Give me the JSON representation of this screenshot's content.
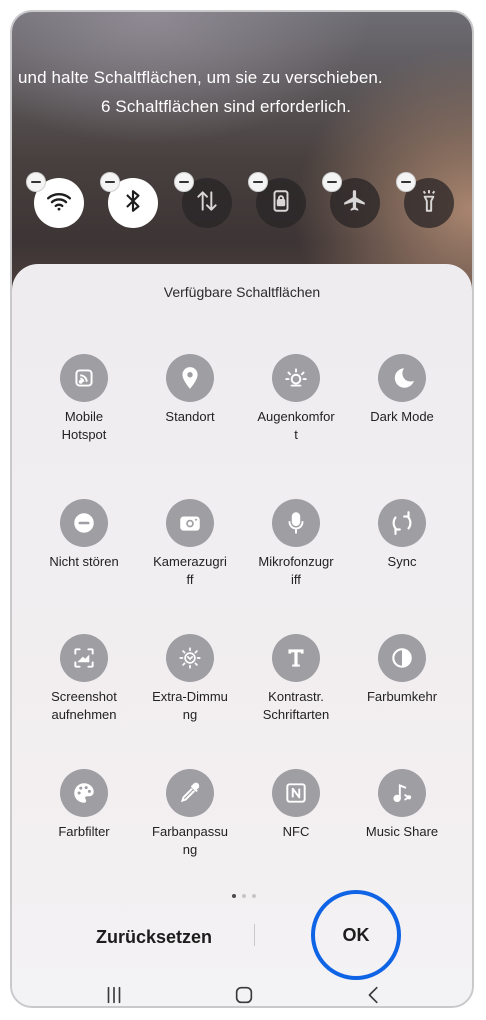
{
  "instructions": {
    "line1": "und halte Schaltflächen, um sie zu verschieben.",
    "line2": "6 Schaltflächen sind erforderlich."
  },
  "active_buttons": [
    {
      "icon": "wifi-icon",
      "state": "on"
    },
    {
      "icon": "bluetooth-icon",
      "state": "on"
    },
    {
      "icon": "mobile-data-icon",
      "state": "off"
    },
    {
      "icon": "lock-rotation-icon",
      "state": "off"
    },
    {
      "icon": "airplane-icon",
      "state": "off"
    },
    {
      "icon": "flashlight-icon",
      "state": "off"
    }
  ],
  "panel": {
    "title": "Verfügbare Schaltflächen",
    "tiles": [
      {
        "label": "Mobile\nHotspot",
        "icon": "hotspot-icon"
      },
      {
        "label": "Standort",
        "icon": "location-icon"
      },
      {
        "label": "Augenkomfor\nt",
        "icon": "eye-comfort-icon"
      },
      {
        "label": "Dark Mode",
        "icon": "moon-icon"
      },
      {
        "label": "Nicht stören",
        "icon": "do-not-disturb-icon"
      },
      {
        "label": "Kamerazugri\nff",
        "icon": "camera-icon"
      },
      {
        "label": "Mikrofonzugr\niff",
        "icon": "microphone-icon"
      },
      {
        "label": "Sync",
        "icon": "sync-icon"
      },
      {
        "label": "Screenshot\naufnehmen",
        "icon": "screenshot-icon"
      },
      {
        "label": "Extra-Dimmu\nng",
        "icon": "extra-dim-icon"
      },
      {
        "label": "Kontrastr.\nSchriftarten",
        "icon": "text-contrast-icon"
      },
      {
        "label": "Farbumkehr",
        "icon": "color-inversion-icon"
      },
      {
        "label": "Farbfilter",
        "icon": "palette-icon"
      },
      {
        "label": "Farbanpassu\nng",
        "icon": "color-picker-icon"
      },
      {
        "label": "NFC",
        "icon": "nfc-icon"
      },
      {
        "label": "Music Share",
        "icon": "music-share-icon"
      }
    ]
  },
  "page_indicator": {
    "current": 1,
    "total": 3
  },
  "actions": {
    "reset_label": "Zurücksetzen",
    "ok_label": "OK",
    "highlight_color": "#0f64e6"
  },
  "navigation": [
    "recent-apps-icon",
    "home-icon",
    "back-icon"
  ]
}
